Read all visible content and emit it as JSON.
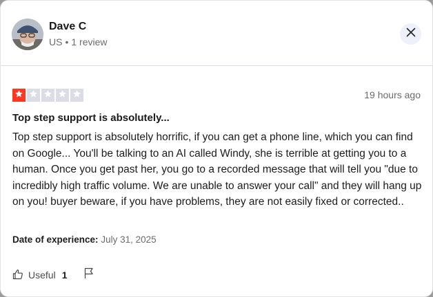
{
  "reviewer": {
    "name": "Dave C",
    "country": "US",
    "separator": "•",
    "review_count": "1 review"
  },
  "review": {
    "rating": 1,
    "max_rating": 5,
    "time_ago": "19 hours ago",
    "title": "Top step support is absolutely...",
    "text": "Top step support is absolutely horrific, if you can get a phone line, which you can find on Google... You'll be talking to an AI called Windy, she is terrible at getting you to a human. Once you get past her, you go to a recorded message that will tell you \"due to incredibly high traffic volume. We are unable to answer your call\" and they will hang up on you! buyer beware, if you have problems, they are not easily fixed or corrected..",
    "experience_label": "Date of experience:",
    "experience_date": "July 31, 2025"
  },
  "actions": {
    "useful_label": "Useful",
    "useful_count": "1"
  },
  "colors": {
    "star_filled": "#ff3722",
    "star_empty": "#dcdce6",
    "close_bg": "#eef0fb"
  },
  "icons": {
    "close": "close-icon",
    "useful": "thumbs-up-icon",
    "flag": "flag-icon",
    "star": "star-icon"
  }
}
